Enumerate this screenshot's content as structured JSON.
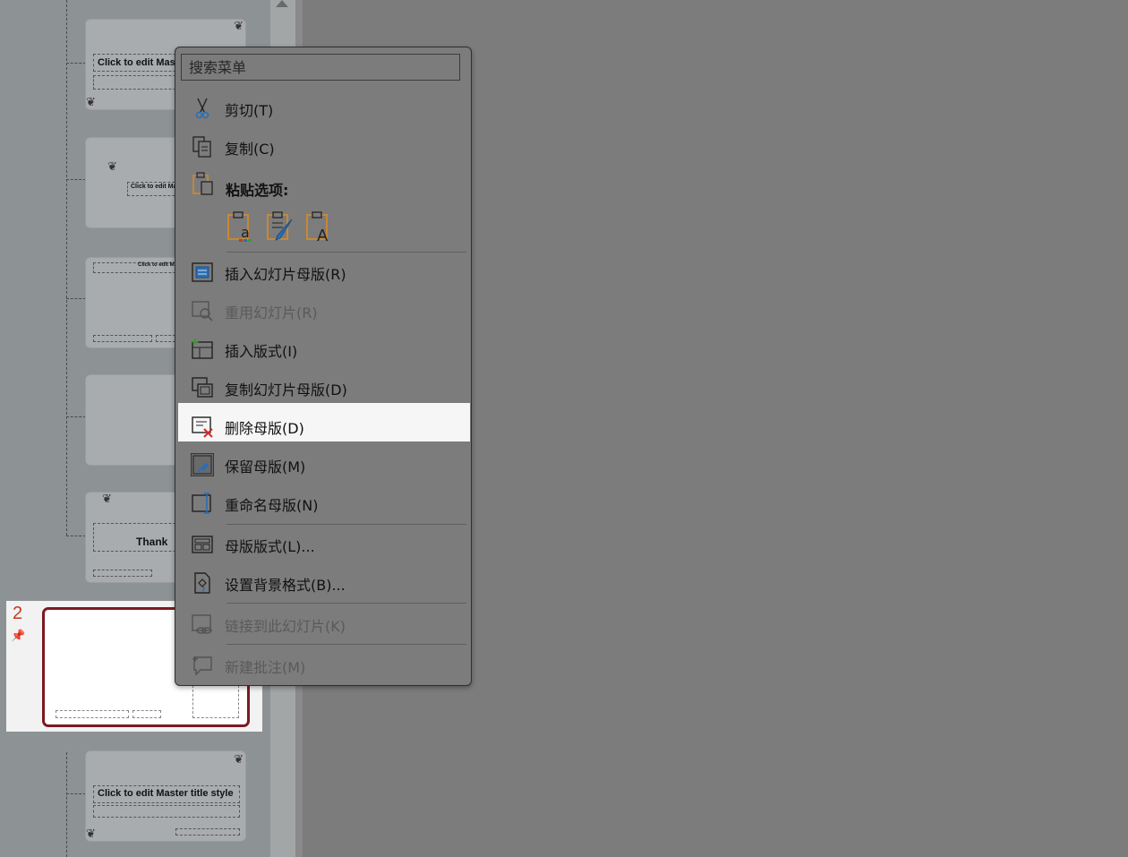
{
  "context_menu": {
    "search_placeholder": "搜索菜单",
    "items": {
      "cut": "剪切(T)",
      "copy": "复制(C)",
      "paste_options": "粘贴选项:",
      "insert_master": "插入幻灯片母版(R)",
      "reuse_slides": "重用幻灯片(R)",
      "insert_layout": "插入版式(I)",
      "duplicate_master": "复制幻灯片母版(D)",
      "delete_master": "删除母版(D)",
      "preserve_master": "保留母版(M)",
      "rename_master": "重命名母版(N)",
      "master_layout": "母版版式(L)...",
      "format_background": "设置背景格式(B)...",
      "link_to_slide": "链接到此幻灯片(K)",
      "new_comment": "新建批注(M)"
    }
  },
  "slide_panel": {
    "selected_number": "2",
    "thumb1_title": "Click to edit Mas",
    "thumb2_title": "Click to edit Mast",
    "thumb3_title": "Click to edit Mast",
    "thumb5_title": "Thank",
    "thumb7_title": "Click to edit Master title style"
  },
  "colors": {
    "accent_red": "#c43b1d",
    "selection_border": "#7b1a22",
    "icon_blue": "#2a6fb5"
  }
}
